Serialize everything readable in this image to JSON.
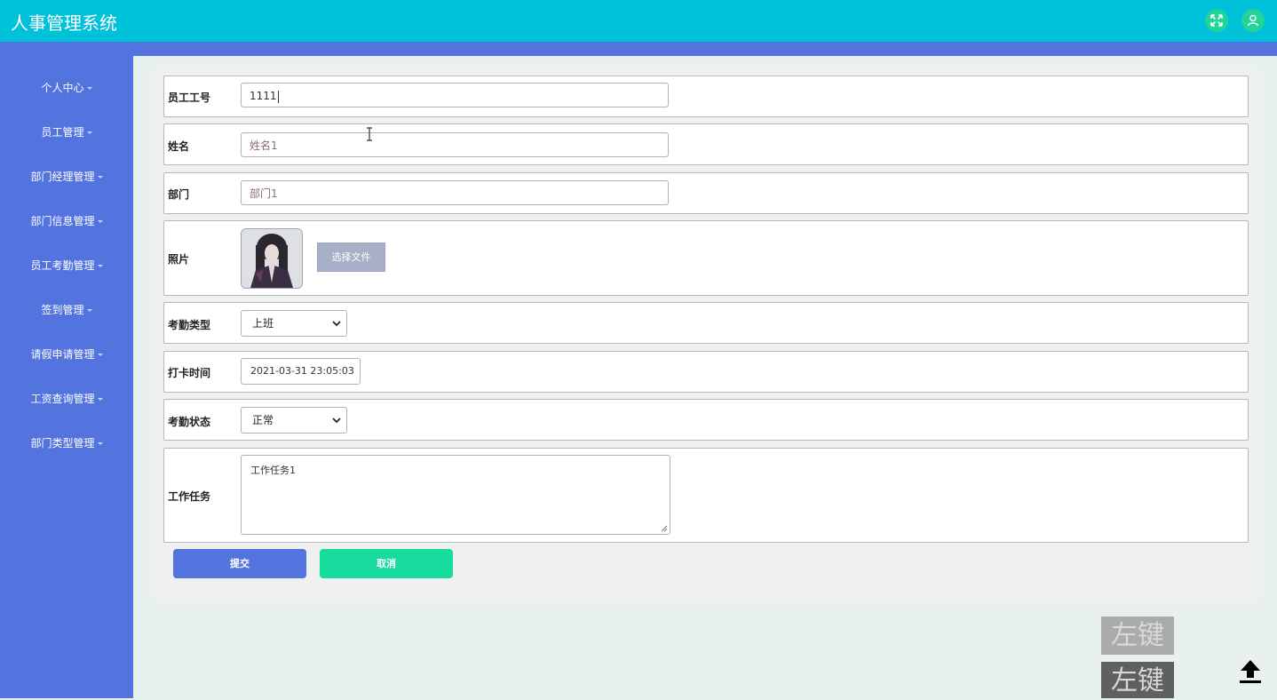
{
  "header": {
    "title": "人事管理系统",
    "fullscreen_icon": "fullscreen-icon",
    "user_icon": "user-icon"
  },
  "sidebar": {
    "items": [
      {
        "label": "个人中心"
      },
      {
        "label": "员工管理"
      },
      {
        "label": "部门经理管理"
      },
      {
        "label": "部门信息管理"
      },
      {
        "label": "员工考勤管理"
      },
      {
        "label": "签到管理"
      },
      {
        "label": "请假申请管理"
      },
      {
        "label": "工资查询管理"
      },
      {
        "label": "部门类型管理"
      }
    ]
  },
  "form": {
    "employee_no": {
      "label": "员工工号",
      "value": "1111"
    },
    "name": {
      "label": "姓名",
      "value": "姓名1"
    },
    "department": {
      "label": "部门",
      "value": "部门1"
    },
    "photo": {
      "label": "照片",
      "file_button": "选择文件"
    },
    "attendance_type": {
      "label": "考勤类型",
      "value": "上班"
    },
    "clock_time": {
      "label": "打卡时间",
      "value": "2021-03-31 23:05:03"
    },
    "attendance_status": {
      "label": "考勤状态",
      "value": "正常"
    },
    "work_task": {
      "label": "工作任务",
      "value": "工作任务1"
    }
  },
  "actions": {
    "submit": "提交",
    "cancel": "取消"
  },
  "overlay": {
    "key_hint_1": "左键",
    "key_hint_2": "左键"
  },
  "colors": {
    "topbar": "#00c1da",
    "sidebar": "#5374de",
    "submit": "#5374de",
    "cancel": "#17dc9d"
  }
}
